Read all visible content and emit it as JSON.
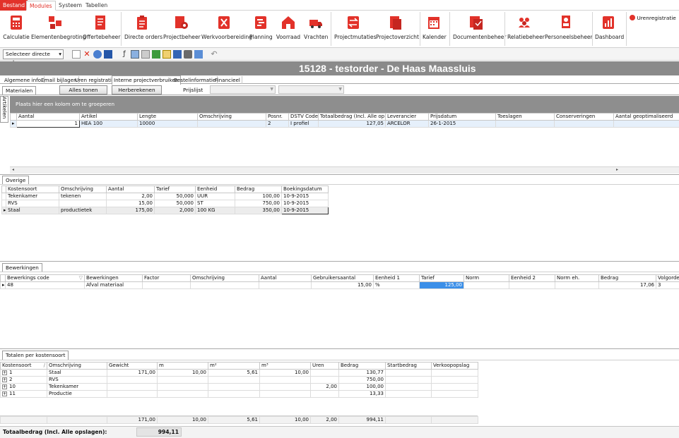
{
  "menu": {
    "tabs": [
      "Bestand",
      "Modules",
      "Systeem",
      "Tabellen"
    ]
  },
  "ribbon": {
    "buttons": [
      "Calculatie",
      "Elementenbegroting",
      "Offertebeheer",
      "Directe orders",
      "Projectbeheer",
      "Werkvoorbereiding",
      "Planning",
      "Voorraad",
      "Vrachten",
      "Projectmutaties",
      "Projectoverzicht",
      "Kalender",
      "Documentenbeheer",
      "Relatiebeheer",
      "Personeelsbeheer",
      "Dashboard"
    ],
    "urenregistratie": "Urenregistratie"
  },
  "toolbar": {
    "select_order": "Selecteer directe order"
  },
  "title": "15128 - testorder - De Haas Maassluis",
  "subtabs": [
    "Algemene info.",
    "Email bijlagen",
    "Uren registratie",
    "Interne projectverbruiken",
    "Bestelinformatie",
    "Financieel"
  ],
  "materialen": {
    "tab": "Materialen",
    "side_tab": "Artikelen",
    "btn_alles": "Alles tonen",
    "btn_herbereken": "Herberekenen",
    "prijslijst_label": "Prijslijst",
    "group_hint": "Plaats hier een kolom om te groeperen",
    "headers": [
      "Aantal",
      "Artikel",
      "Lengte",
      "Omschrijving",
      "Posnr.",
      "DSTV Code",
      "Totaalbedrag (Incl. Alle op",
      "Leverancier",
      "Prijsdatum",
      "Toeslagen",
      "Conserveringen",
      "Aantal geoptimaliseerd"
    ],
    "rows": [
      [
        "1",
        "HEA  100",
        "10000",
        "",
        "2",
        "I profiel",
        "127,05",
        "ARCELOR",
        "26-1-2015",
        "",
        "",
        ""
      ]
    ]
  },
  "overige": {
    "tab": "Overige",
    "headers": [
      "Kostensoort",
      "Omschrijving",
      "Aantal",
      "Tarief",
      "Eenheid",
      "Bedrag",
      "Boekingsdatum"
    ],
    "rows": [
      [
        "Tekenkamer",
        "tekenen",
        "2,00",
        "50,000",
        "UUR",
        "100,00",
        "10-9-2015"
      ],
      [
        "RVS",
        "",
        "15,00",
        "50,000",
        "ST",
        "750,00",
        "10-9-2015"
      ],
      [
        "Staal",
        "productietek",
        "175,00",
        "2,000",
        "100 KG",
        "350,00",
        "10-9-2015"
      ]
    ]
  },
  "bewerkingen": {
    "tab": "Bewerkingen",
    "headers": [
      "Bewerkings code",
      "Bewerkingen",
      "Factor",
      "Omschrijving",
      "Aantal",
      "Gebruikersaantal",
      "Eenheid 1",
      "Tarief",
      "Norm",
      "Eenheid 2",
      "Norm eh.",
      "Bedrag",
      "Volgorde"
    ],
    "rows": [
      [
        "48",
        "Afval materiaal",
        "",
        "",
        "",
        "15,00",
        "%",
        "125,00",
        "",
        "",
        "",
        "17,06",
        "3"
      ]
    ]
  },
  "totalen": {
    "tab": "Totalen per kostensoort",
    "headers": [
      "Kostensoort",
      "Omschrijving",
      "Gewicht",
      "m",
      "m²",
      "m³",
      "Uren",
      "Bedrag",
      "Startbedrag",
      "Verkoopopslag"
    ],
    "rows": [
      [
        "1",
        "Staal",
        "171,00",
        "10,00",
        "5,61",
        "10,00",
        "",
        "130,77",
        "",
        ""
      ],
      [
        "2",
        "RVS",
        "",
        "",
        "",
        "",
        "",
        "750,00",
        "",
        ""
      ],
      [
        "10",
        "Tekenkamer",
        "",
        "",
        "",
        "",
        "2,00",
        "100,00",
        "",
        ""
      ],
      [
        "11",
        "Productie",
        "",
        "",
        "",
        "",
        "",
        "13,33",
        "",
        ""
      ]
    ],
    "footer": [
      "",
      "",
      "171,00",
      "10,00",
      "5,61",
      "10,00",
      "2,00",
      "994,11",
      "",
      ""
    ],
    "total_label": "Totaalbedrag (Incl. Alle opslagen):",
    "total_value": "994,11"
  },
  "colors": {
    "accent": "#e2322a",
    "titlebar": "#8a8a8a",
    "selected_cell": "#3b8fe8"
  }
}
